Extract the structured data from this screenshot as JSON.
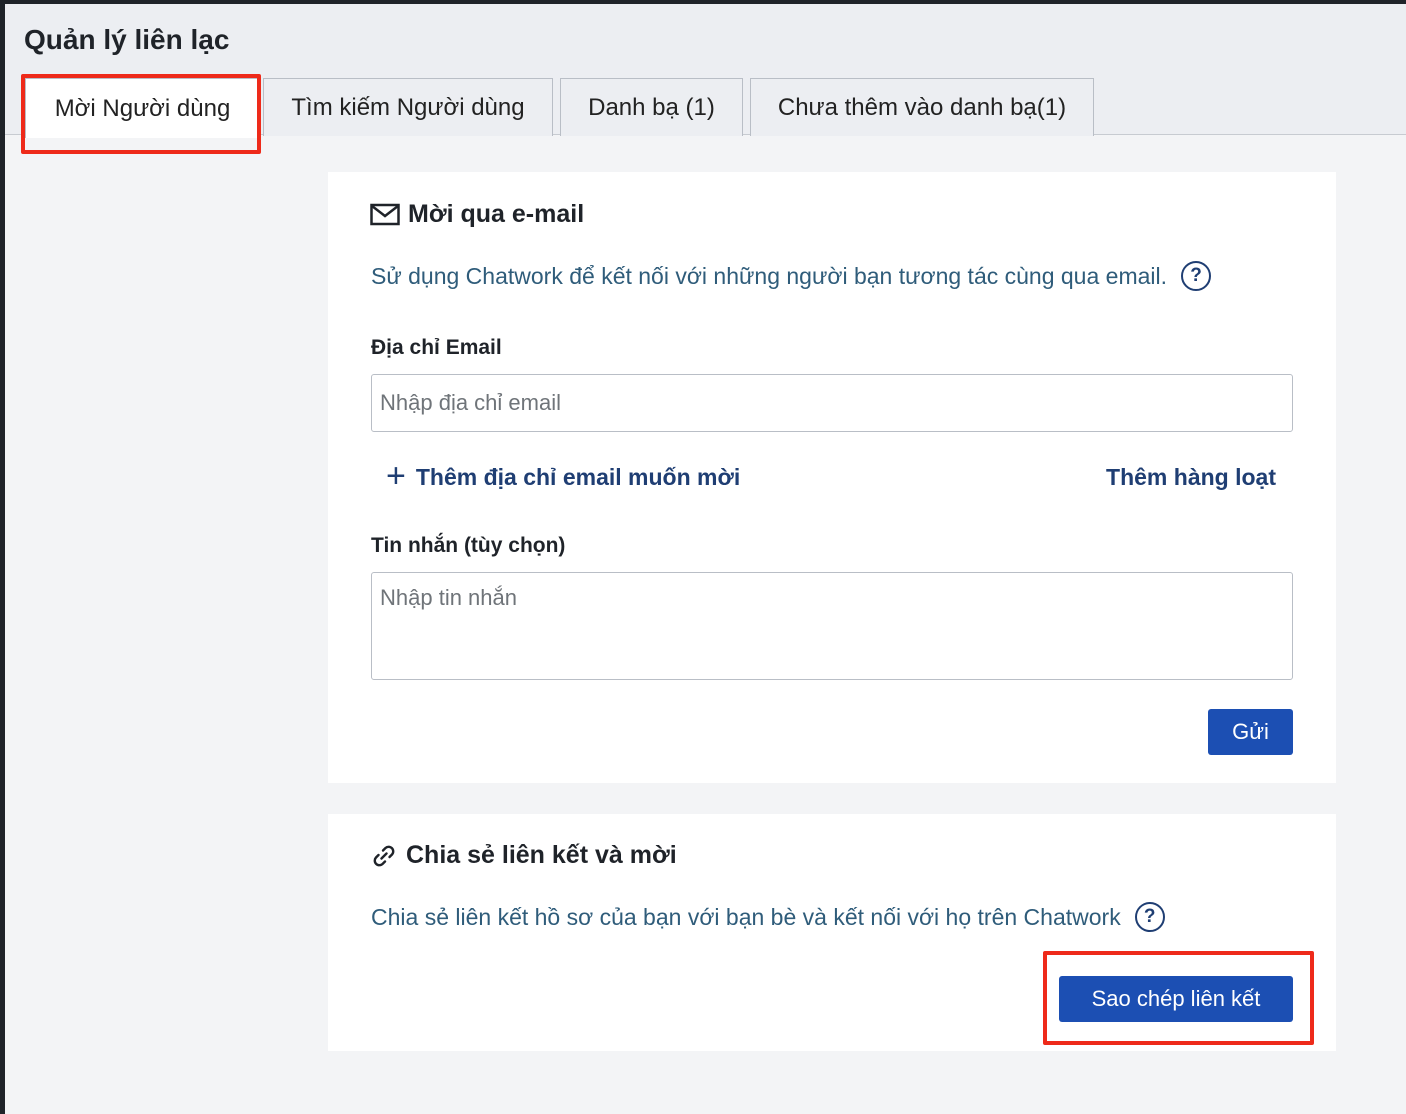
{
  "window": {
    "title": "Quản lý liên lạc"
  },
  "tabs": [
    {
      "label": "Mời Người dùng",
      "active": true
    },
    {
      "label": "Tìm kiếm Người dùng",
      "active": false
    },
    {
      "label": "Danh bạ (1)",
      "active": false
    },
    {
      "label": "Chưa thêm vào danh bạ(1)",
      "active": false
    }
  ],
  "email_invite": {
    "icon": "envelope-icon",
    "title": "Mời qua e-mail",
    "description": "Sử dụng Chatwork để kết nối với những người bạn tương tác cùng qua email.",
    "email_label": "Địa chỉ Email",
    "email_placeholder": "Nhập địa chỉ email",
    "email_value": "",
    "add_email_label": "Thêm địa chỉ email muốn mời",
    "bulk_add_label": "Thêm hàng loạt",
    "message_label": "Tin nhắn (tùy chọn)",
    "message_placeholder": "Nhập tin nhắn",
    "message_value": "",
    "send_label": "Gửi"
  },
  "share_link": {
    "icon": "link-icon",
    "title": "Chia sẻ liên kết và mời",
    "description": "Chia sẻ liên kết hồ sơ của bạn với bạn bè và kết nối với họ trên Chatwork",
    "copy_label": "Sao chép liên kết"
  },
  "colors": {
    "accent_button": "#1c4fb3",
    "link_text": "#1f3e73",
    "description_text": "#2f5c7a",
    "annotation_highlight": "#ee2a1a"
  }
}
